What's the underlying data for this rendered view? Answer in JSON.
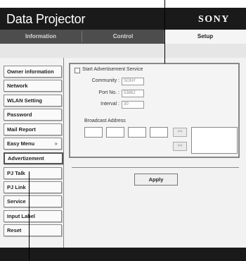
{
  "header": {
    "title": "Data Projector",
    "brand": "SONY"
  },
  "tabs": [
    {
      "label": "Information"
    },
    {
      "label": "Control"
    },
    {
      "label": "Setup"
    }
  ],
  "sidebar": {
    "items": [
      {
        "label": "Owner information"
      },
      {
        "label": "Network"
      },
      {
        "label": "WLAN Setting"
      },
      {
        "label": "Password"
      },
      {
        "label": "Mail Report"
      },
      {
        "label": "Easy Menu",
        "chevron": "»"
      },
      {
        "label": "Advertizement",
        "selected": true
      },
      {
        "label": "PJ Talk"
      },
      {
        "label": "PJ Link"
      },
      {
        "label": "Service"
      },
      {
        "label": "Input Label"
      },
      {
        "label": "Reset"
      }
    ]
  },
  "advertisement": {
    "start_label": "Start Advertisement Service",
    "community_label": "Community :",
    "community_value": "SONY",
    "port_label": "Port No. :",
    "port_value": "53862",
    "interval_label": "Interval :",
    "interval_value": "30",
    "broadcast_label": "Broadcast Address",
    "add_btn": ">>",
    "remove_btn": "<<"
  },
  "apply_label": "Apply"
}
